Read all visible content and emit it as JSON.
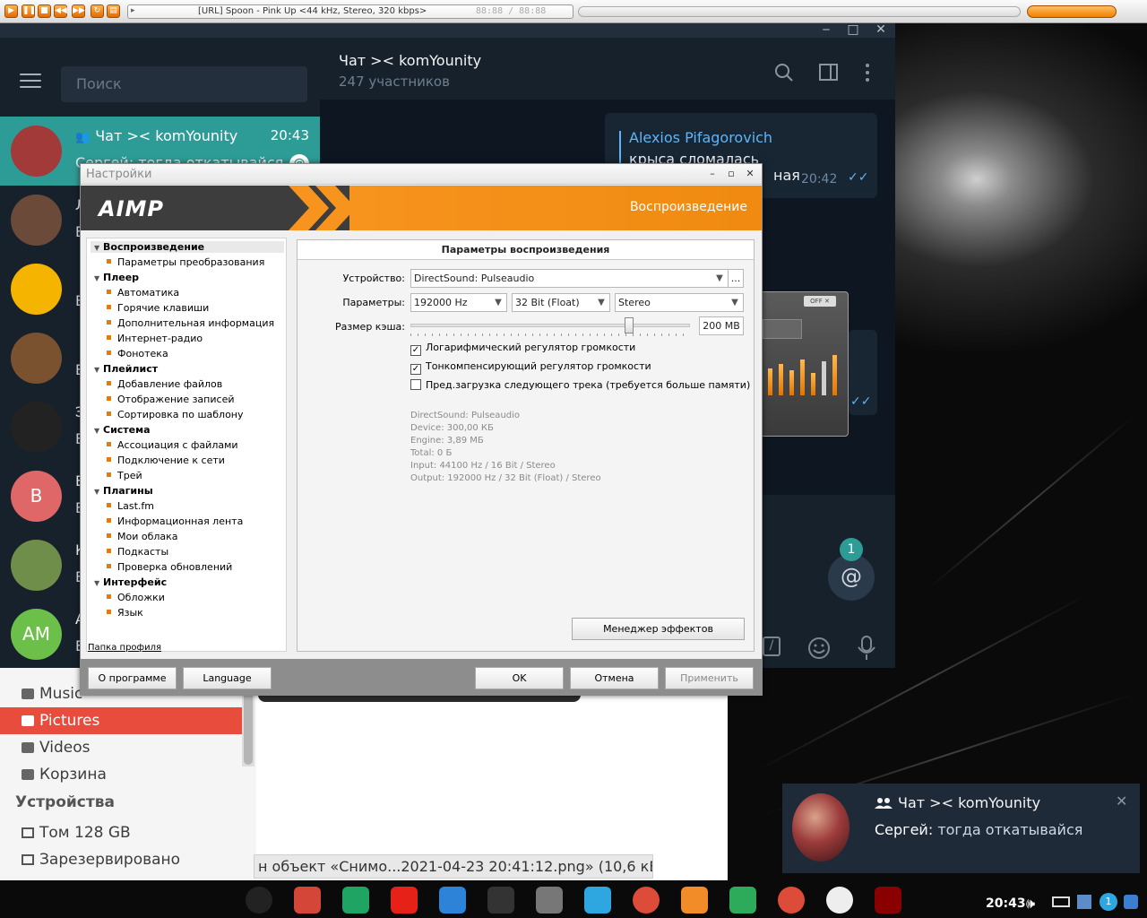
{
  "aimp_bar": {
    "track": "[URL] Spoon - Pink Up <44 kHz, Stereo, 320 kbps>",
    "time": "88:88 / 88:88",
    "buttons": [
      "play-icon",
      "pause-icon",
      "stop-icon",
      "prev-icon",
      "next-icon",
      "open-icon"
    ]
  },
  "telegram": {
    "search_placeholder": "Поиск",
    "chat_title": "Чат >< komYounity",
    "chat_subtitle": "247 участников",
    "chats": [
      {
        "name": "Чат >< komYounity",
        "time": "20:43",
        "message": "Сергей: тогда откатывайся",
        "mention": "@",
        "avatar_color": "#a33a3a"
      },
      {
        "name": "Л",
        "message": "Е",
        "avatar_color": "#6b4a3a"
      },
      {
        "name": "",
        "message": "Е",
        "avatar_color": "#f4b400"
      },
      {
        "name": "",
        "message": "Е",
        "avatar_color": "#7a5230"
      },
      {
        "name": "Э",
        "message": "Е",
        "avatar_color": "#222222"
      },
      {
        "name": "Е",
        "message": "Е",
        "avatar_initial": "В",
        "avatar_color": "#e06767"
      },
      {
        "name": "К",
        "message": "Е",
        "avatar_color": "#6f8e4a"
      },
      {
        "name": "А",
        "message": "Е",
        "avatar_initial": "АМ",
        "avatar_color": "#6cc04a"
      }
    ],
    "message": {
      "author": "Alexios Pifagorovich",
      "text": "крыса сломалась",
      "tail": "ная",
      "time": "20:42"
    },
    "unread_badge": "1",
    "mention_button": "@"
  },
  "file_manager": {
    "items": [
      {
        "label": "Music",
        "icon": "headphones-icon",
        "selected": false
      },
      {
        "label": "Pictures",
        "icon": "camera-icon",
        "selected": true
      },
      {
        "label": "Videos",
        "icon": "video-icon",
        "selected": false
      },
      {
        "label": "Корзина",
        "icon": "trash-icon",
        "selected": false
      }
    ],
    "section_devices": "Устройства",
    "devices": [
      {
        "label": "Том 128 GB",
        "icon": "drive-icon"
      },
      {
        "label": "Зарезервировано систем…",
        "icon": "drive-icon"
      }
    ],
    "status": "н объект «Снимо...2021-04-23 20:41:12.png» (10,6 кБ)"
  },
  "settings": {
    "window_title": "Настройки",
    "banner_logo": "AIMP",
    "banner_title": "Воспроизведение",
    "tree": [
      {
        "label": "Воспроизведение",
        "level": 0,
        "selected": true
      },
      {
        "label": "Параметры преобразования",
        "level": 1
      },
      {
        "label": "Плеер",
        "level": 0
      },
      {
        "label": "Автоматика",
        "level": 1
      },
      {
        "label": "Горячие клавиши",
        "level": 1
      },
      {
        "label": "Дополнительная информация",
        "level": 1
      },
      {
        "label": "Интернет-радио",
        "level": 1
      },
      {
        "label": "Фонотека",
        "level": 1
      },
      {
        "label": "Плейлист",
        "level": 0
      },
      {
        "label": "Добавление файлов",
        "level": 1
      },
      {
        "label": "Отображение записей",
        "level": 1
      },
      {
        "label": "Сортировка по шаблону",
        "level": 1
      },
      {
        "label": "Система",
        "level": 0
      },
      {
        "label": "Ассоциация с файлами",
        "level": 1
      },
      {
        "label": "Подключение к сети",
        "level": 1
      },
      {
        "label": "Трей",
        "level": 1
      },
      {
        "label": "Плагины",
        "level": 0
      },
      {
        "label": "Last.fm",
        "level": 1
      },
      {
        "label": "Информационная лента",
        "level": 1
      },
      {
        "label": "Мои облака",
        "level": 1
      },
      {
        "label": "Подкасты",
        "level": 1
      },
      {
        "label": "Проверка обновлений",
        "level": 1
      },
      {
        "label": "Интерфейс",
        "level": 0
      },
      {
        "label": "Обложки",
        "level": 1
      },
      {
        "label": "Язык",
        "level": 1
      }
    ],
    "profile_link": "Папка профиля",
    "panel_title": "Параметры воспроизведения",
    "device_label": "Устройство:",
    "device_value": "DirectSound: Pulseaudio",
    "device_more": "...",
    "params_label": "Параметры:",
    "freq": "192000 Hz",
    "bits": "32 Bit (Float)",
    "channels": "Stereo",
    "cache_label": "Размер кэша:",
    "cache_value": "200 MB",
    "cache_fraction": 0.78,
    "checks": [
      {
        "label": "Логарифмический регулятор громкости",
        "checked": true
      },
      {
        "label": "Тонкомпенсирующий регулятор громкости",
        "checked": true
      },
      {
        "label": "Пред.загрузка следующего трека (требуется больше памяти)",
        "checked": false
      }
    ],
    "info": [
      "DirectSound: Pulseaudio",
      "Device: 300,00 КБ",
      "Engine: 3,89 МБ",
      "Total: 0 Б",
      "Input: 44100 Hz / 16 Bit / Stereo",
      "Output: 192000 Hz / 32 Bit (Float) / Stereo"
    ],
    "effects_button": "Менеджер эффектов",
    "about_button": "О программе",
    "language_button": "Language",
    "ok_button": "OK",
    "cancel_button": "Отмена",
    "apply_button": "Применить"
  },
  "notification": {
    "title": "Чат >< komYounity",
    "sender": "Сергей:",
    "text": "тогда откатывайся"
  },
  "taskbar": {
    "clock": "20:43",
    "apps": [
      "search-icon",
      "gmail-icon",
      "drive-icon",
      "youtube-icon",
      "files-icon",
      "terminal-icon",
      "trash-icon",
      "telegram-icon",
      "chrome-icon",
      "vlc-icon",
      "tixati-icon",
      "chrome-icon",
      "a-icon",
      "wine-icon"
    ]
  }
}
